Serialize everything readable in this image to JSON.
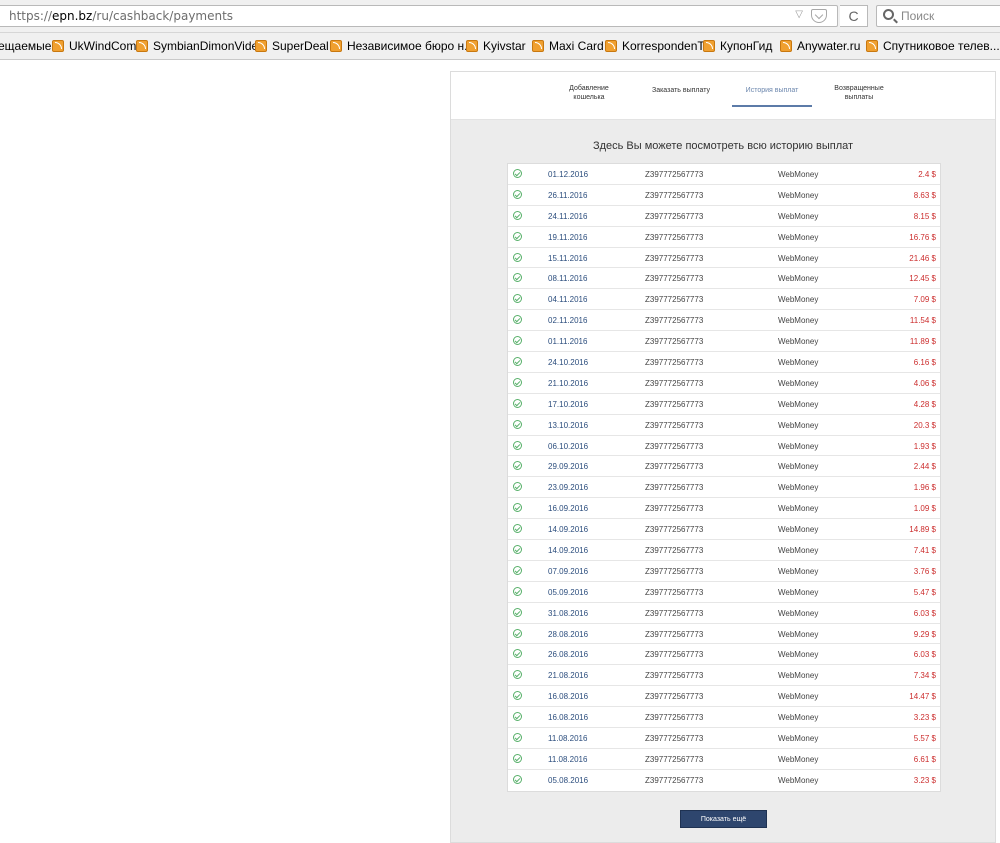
{
  "browser": {
    "url_prefix": "https://",
    "url_host": "epn.bz",
    "url_path": "/ru/cashback/payments",
    "reload_glyph": "C",
    "search_placeholder": "Поиск"
  },
  "bookmarks": [
    "ещаемые",
    "UkWindCom",
    "SymbianDimonVideo",
    "SuperDeal",
    "Независимое бюро н...",
    "Kyivstar",
    "Maxi Card",
    "KorrespondenT",
    "КупонГид",
    "Anywater.ru",
    "Спутниковое телев..."
  ],
  "tabs": {
    "add_wallet": "Добавление кошелька",
    "order_payout": "Заказать выплату",
    "history": "История выплат",
    "returned": "Возвращенные выплаты"
  },
  "heading": "Здесь Вы можете посмотреть всю историю выплат",
  "payments": [
    {
      "date": "01.12.2016",
      "wallet": "Z397772567773",
      "system": "WebMoney",
      "amount": "2.4 $"
    },
    {
      "date": "26.11.2016",
      "wallet": "Z397772567773",
      "system": "WebMoney",
      "amount": "8.63 $"
    },
    {
      "date": "24.11.2016",
      "wallet": "Z397772567773",
      "system": "WebMoney",
      "amount": "8.15 $"
    },
    {
      "date": "19.11.2016",
      "wallet": "Z397772567773",
      "system": "WebMoney",
      "amount": "16.76 $"
    },
    {
      "date": "15.11.2016",
      "wallet": "Z397772567773",
      "system": "WebMoney",
      "amount": "21.46 $"
    },
    {
      "date": "08.11.2016",
      "wallet": "Z397772567773",
      "system": "WebMoney",
      "amount": "12.45 $"
    },
    {
      "date": "04.11.2016",
      "wallet": "Z397772567773",
      "system": "WebMoney",
      "amount": "7.09 $"
    },
    {
      "date": "02.11.2016",
      "wallet": "Z397772567773",
      "system": "WebMoney",
      "amount": "11.54 $"
    },
    {
      "date": "01.11.2016",
      "wallet": "Z397772567773",
      "system": "WebMoney",
      "amount": "11.89 $"
    },
    {
      "date": "24.10.2016",
      "wallet": "Z397772567773",
      "system": "WebMoney",
      "amount": "6.16 $"
    },
    {
      "date": "21.10.2016",
      "wallet": "Z397772567773",
      "system": "WebMoney",
      "amount": "4.06 $"
    },
    {
      "date": "17.10.2016",
      "wallet": "Z397772567773",
      "system": "WebMoney",
      "amount": "4.28 $"
    },
    {
      "date": "13.10.2016",
      "wallet": "Z397772567773",
      "system": "WebMoney",
      "amount": "20.3 $"
    },
    {
      "date": "06.10.2016",
      "wallet": "Z397772567773",
      "system": "WebMoney",
      "amount": "1.93 $"
    },
    {
      "date": "29.09.2016",
      "wallet": "Z397772567773",
      "system": "WebMoney",
      "amount": "2.44 $"
    },
    {
      "date": "23.09.2016",
      "wallet": "Z397772567773",
      "system": "WebMoney",
      "amount": "1.96 $"
    },
    {
      "date": "16.09.2016",
      "wallet": "Z397772567773",
      "system": "WebMoney",
      "amount": "1.09 $"
    },
    {
      "date": "14.09.2016",
      "wallet": "Z397772567773",
      "system": "WebMoney",
      "amount": "14.89 $"
    },
    {
      "date": "14.09.2016",
      "wallet": "Z397772567773",
      "system": "WebMoney",
      "amount": "7.41 $"
    },
    {
      "date": "07.09.2016",
      "wallet": "Z397772567773",
      "system": "WebMoney",
      "amount": "3.76 $"
    },
    {
      "date": "05.09.2016",
      "wallet": "Z397772567773",
      "system": "WebMoney",
      "amount": "5.47 $"
    },
    {
      "date": "31.08.2016",
      "wallet": "Z397772567773",
      "system": "WebMoney",
      "amount": "6.03 $"
    },
    {
      "date": "28.08.2016",
      "wallet": "Z397772567773",
      "system": "WebMoney",
      "amount": "9.29 $"
    },
    {
      "date": "26.08.2016",
      "wallet": "Z397772567773",
      "system": "WebMoney",
      "amount": "6.03 $"
    },
    {
      "date": "21.08.2016",
      "wallet": "Z397772567773",
      "system": "WebMoney",
      "amount": "7.34 $"
    },
    {
      "date": "16.08.2016",
      "wallet": "Z397772567773",
      "system": "WebMoney",
      "amount": "14.47 $"
    },
    {
      "date": "16.08.2016",
      "wallet": "Z397772567773",
      "system": "WebMoney",
      "amount": "3.23 $"
    },
    {
      "date": "11.08.2016",
      "wallet": "Z397772567773",
      "system": "WebMoney",
      "amount": "5.57 $"
    },
    {
      "date": "11.08.2016",
      "wallet": "Z397772567773",
      "system": "WebMoney",
      "amount": "6.61 $"
    },
    {
      "date": "05.08.2016",
      "wallet": "Z397772567773",
      "system": "WebMoney",
      "amount": "3.23 $"
    }
  ],
  "show_more": "Показать ещё",
  "colors": {
    "accent": "#2e466e",
    "active_tab": "#5c7ba8",
    "amount": "#cc2d2d",
    "success": "#58b06a"
  }
}
